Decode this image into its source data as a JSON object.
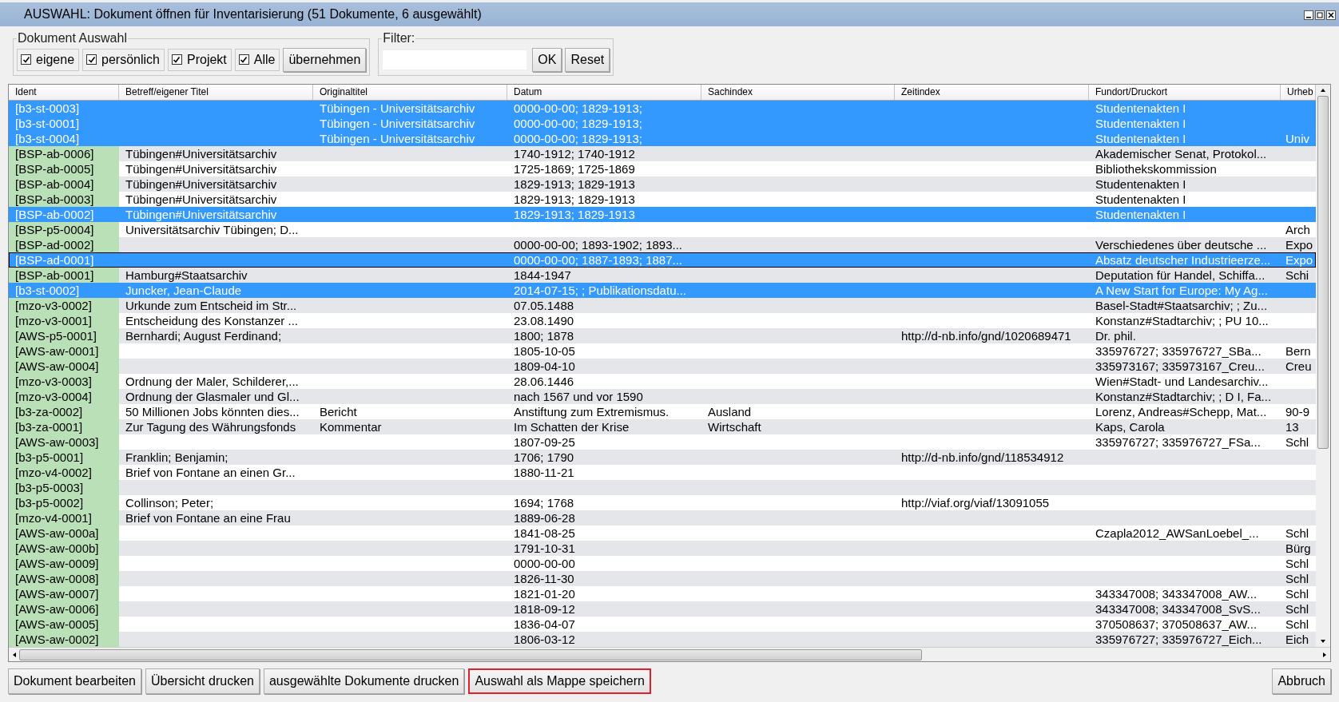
{
  "window": {
    "title": "AUSWAHL: Dokument öffnen für Inventarisierung (51 Dokumente, 6 ausgewählt)"
  },
  "document_selection": {
    "legend": "Dokument Auswahl",
    "checkboxes": [
      {
        "label": "eigene",
        "checked": true
      },
      {
        "label": "persönlich",
        "checked": true
      },
      {
        "label": "Projekt",
        "checked": true
      },
      {
        "label": "Alle",
        "checked": true
      }
    ],
    "apply_button": "übernehmen"
  },
  "filter": {
    "legend": "Filter:",
    "ok_button": "OK",
    "reset_button": "Reset"
  },
  "table": {
    "columns": [
      "Ident",
      "Betreff/eigener Titel",
      "Originaltitel",
      "Datum",
      "Sachindex",
      "Zeitindex",
      "Fundort/Druckort",
      "Urheb"
    ],
    "rows": [
      {
        "selected": true,
        "focused": false,
        "cells": [
          "[b3-st-0003]",
          "",
          "Tübingen - Universitätsarchiv",
          "0000-00-00; 1829-1913;",
          "",
          "",
          "Studentenakten I",
          ""
        ]
      },
      {
        "selected": true,
        "focused": false,
        "cells": [
          "[b3-st-0001]",
          "",
          "Tübingen - Universitätsarchiv",
          "0000-00-00; 1829-1913;",
          "",
          "",
          "Studentenakten I",
          ""
        ]
      },
      {
        "selected": true,
        "focused": false,
        "cells": [
          "[b3-st-0004]",
          "",
          "Tübingen - Universitätsarchiv",
          "0000-00-00; 1829-1913;",
          "",
          "",
          "Studentenakten I",
          "Univ"
        ]
      },
      {
        "selected": false,
        "focused": false,
        "cells": [
          "[BSP-ab-0006]",
          "Tübingen#Universitätsarchiv",
          "",
          "1740-1912; 1740-1912",
          "",
          "",
          "Akademischer Senat, Protokol...",
          ""
        ]
      },
      {
        "selected": false,
        "focused": false,
        "cells": [
          "[BSP-ab-0005]",
          "Tübingen#Universitätsarchiv",
          "",
          "1725-1869; 1725-1869",
          "",
          "",
          "Bibliothekskommission",
          ""
        ]
      },
      {
        "selected": false,
        "focused": false,
        "cells": [
          "[BSP-ab-0004]",
          "Tübingen#Universitätsarchiv",
          "",
          "1829-1913; 1829-1913",
          "",
          "",
          "Studentenakten I",
          ""
        ]
      },
      {
        "selected": false,
        "focused": false,
        "cells": [
          "[BSP-ab-0003]",
          "Tübingen#Universitätsarchiv",
          "",
          "1829-1913; 1829-1913",
          "",
          "",
          "Studentenakten I",
          ""
        ]
      },
      {
        "selected": true,
        "focused": false,
        "cells": [
          "[BSP-ab-0002]",
          "Tübingen#Universitätsarchiv",
          "",
          "1829-1913; 1829-1913",
          "",
          "",
          "Studentenakten I",
          ""
        ]
      },
      {
        "selected": false,
        "focused": false,
        "cells": [
          "[BSP-p5-0004]",
          "Universitätsarchiv Tübingen; D...",
          "",
          "",
          "",
          "",
          "",
          "Arch"
        ]
      },
      {
        "selected": false,
        "focused": false,
        "cells": [
          "[BSP-ad-0002]",
          "",
          "",
          "0000-00-00; 1893-1902; 1893...",
          "",
          "",
          "Verschiedenes über deutsche ...",
          "Expo"
        ]
      },
      {
        "selected": true,
        "focused": true,
        "cells": [
          "[BSP-ad-0001]",
          "",
          "",
          "0000-00-00; 1887-1893; 1887...",
          "",
          "",
          "Absatz deutscher Industrieerze...",
          "Expo"
        ]
      },
      {
        "selected": false,
        "focused": false,
        "cells": [
          "[BSP-ab-0001]",
          "Hamburg#Staatsarchiv",
          "",
          "1844-1947",
          "",
          "",
          "Deputation für Handel, Schiffa...",
          "Schi"
        ]
      },
      {
        "selected": true,
        "focused": false,
        "cells": [
          "[b3-st-0002]",
          "Juncker, Jean-Claude",
          "",
          "2014-07-15; ; Publikationsdatu...",
          "",
          "",
          "A New Start for Europe: My Ag...",
          ""
        ]
      },
      {
        "selected": false,
        "focused": false,
        "cells": [
          "[mzo-v3-0002]",
          "Urkunde zum Entscheid im Str...",
          "",
          "07.05.1488",
          "",
          "",
          "Basel-Stadt#Staatsarchiv; ; Zu...",
          ""
        ]
      },
      {
        "selected": false,
        "focused": false,
        "cells": [
          "[mzo-v3-0001]",
          "Entscheidung des Konstanzer ...",
          "",
          "23.08.1490",
          "",
          "",
          "Konstanz#Stadtarchiv; ; PU 10...",
          ""
        ]
      },
      {
        "selected": false,
        "focused": false,
        "cells": [
          "[AWS-p5-0001]",
          "Bernhardi; August Ferdinand;",
          "",
          "1800; 1878",
          "",
          "http://d-nb.info/gnd/1020689471",
          "Dr. phil.",
          ""
        ]
      },
      {
        "selected": false,
        "focused": false,
        "cells": [
          "[AWS-aw-0001]",
          "",
          "",
          "1805-10-05",
          "",
          "",
          "335976727; 335976727_SBa...",
          "Bern"
        ]
      },
      {
        "selected": false,
        "focused": false,
        "cells": [
          "[AWS-aw-0004]",
          "",
          "",
          "1809-04-10",
          "",
          "",
          "335973167; 335973167_Creu...",
          "Creu"
        ]
      },
      {
        "selected": false,
        "focused": false,
        "cells": [
          "[mzo-v3-0003]",
          "Ordnung der Maler, Schilderer,...",
          "",
          "28.06.1446",
          "",
          "",
          "Wien#Stadt- und Landesarchiv...",
          ""
        ]
      },
      {
        "selected": false,
        "focused": false,
        "cells": [
          "[mzo-v3-0004]",
          "Ordnung der Glasmaler und Gl...",
          "",
          "nach 1567 und vor 1590",
          "",
          "",
          "Konstanz#Stadtarchiv; ; D I, Fa...",
          ""
        ]
      },
      {
        "selected": false,
        "focused": false,
        "cells": [
          "[b3-za-0002]",
          "50 Millionen Jobs könnten dies...",
          "Bericht",
          "Anstiftung zum Extremismus.",
          "Ausland",
          "",
          "Lorenz, Andreas#Schepp, Mat...",
          "90-9"
        ]
      },
      {
        "selected": false,
        "focused": false,
        "cells": [
          "[b3-za-0001]",
          "Zur Tagung des Währungsfonds",
          "Kommentar",
          "Im Schatten der Krise",
          "Wirtschaft",
          "",
          "Kaps, Carola",
          "13"
        ]
      },
      {
        "selected": false,
        "focused": false,
        "cells": [
          "[AWS-aw-0003]",
          "",
          "",
          "1807-09-25",
          "",
          "",
          "335976727; 335976727_FSa...",
          "Schl"
        ]
      },
      {
        "selected": false,
        "focused": false,
        "cells": [
          "[b3-p5-0001]",
          "Franklin; Benjamin;",
          "",
          "1706; 1790",
          "",
          "http://d-nb.info/gnd/118534912",
          "",
          ""
        ]
      },
      {
        "selected": false,
        "focused": false,
        "cells": [
          "[mzo-v4-0002]",
          "Brief von Fontane an einen Gr...",
          "",
          "1880-11-21",
          "",
          "",
          "",
          ""
        ]
      },
      {
        "selected": false,
        "focused": false,
        "cells": [
          "[b3-p5-0003]",
          "",
          "",
          "",
          "",
          "",
          "",
          ""
        ]
      },
      {
        "selected": false,
        "focused": false,
        "cells": [
          "[b3-p5-0002]",
          "Collinson; Peter;",
          "",
          "1694; 1768",
          "",
          "http://viaf.org/viaf/13091055",
          "",
          ""
        ]
      },
      {
        "selected": false,
        "focused": false,
        "cells": [
          "[mzo-v4-0001]",
          "Brief von Fontane an eine Frau",
          "",
          "1889-06-28",
          "",
          "",
          "",
          ""
        ]
      },
      {
        "selected": false,
        "focused": false,
        "cells": [
          "[AWS-aw-000a]",
          "",
          "",
          "1841-08-25",
          "",
          "",
          "Czapla2012_AWSanLoebel_...",
          "Schl"
        ]
      },
      {
        "selected": false,
        "focused": false,
        "cells": [
          "[AWS-aw-000b]",
          "",
          "",
          "1791-10-31",
          "",
          "",
          "",
          "Bürg"
        ]
      },
      {
        "selected": false,
        "focused": false,
        "cells": [
          "[AWS-aw-0009]",
          "",
          "",
          "0000-00-00",
          "",
          "",
          "",
          "Schl"
        ]
      },
      {
        "selected": false,
        "focused": false,
        "cells": [
          "[AWS-aw-0008]",
          "",
          "",
          "1826-11-30",
          "",
          "",
          "",
          "Schl"
        ]
      },
      {
        "selected": false,
        "focused": false,
        "cells": [
          "[AWS-aw-0007]",
          "",
          "",
          "1821-01-20",
          "",
          "",
          "343347008; 343347008_AW...",
          "Schl"
        ]
      },
      {
        "selected": false,
        "focused": false,
        "cells": [
          "[AWS-aw-0006]",
          "",
          "",
          "1818-09-12",
          "",
          "",
          "343347008; 343347008_SvS...",
          "Schl"
        ]
      },
      {
        "selected": false,
        "focused": false,
        "cells": [
          "[AWS-aw-0005]",
          "",
          "",
          "1836-04-07",
          "",
          "",
          "370508637; 370508637_AW...",
          "Schl"
        ]
      },
      {
        "selected": false,
        "focused": false,
        "cells": [
          "[AWS-aw-0002]",
          "",
          "",
          "1806-03-12",
          "",
          "",
          "335976727; 335976727_Eich...",
          "Eich"
        ]
      }
    ]
  },
  "buttons": [
    {
      "label": "Dokument bearbeiten",
      "highlighted": false
    },
    {
      "label": "Übersicht drucken",
      "highlighted": false
    },
    {
      "label": "ausgewählte Dokumente drucken",
      "highlighted": false
    },
    {
      "label": "Auswahl als Mappe speichern",
      "highlighted": true
    }
  ],
  "cancel_button": "Abbruch"
}
